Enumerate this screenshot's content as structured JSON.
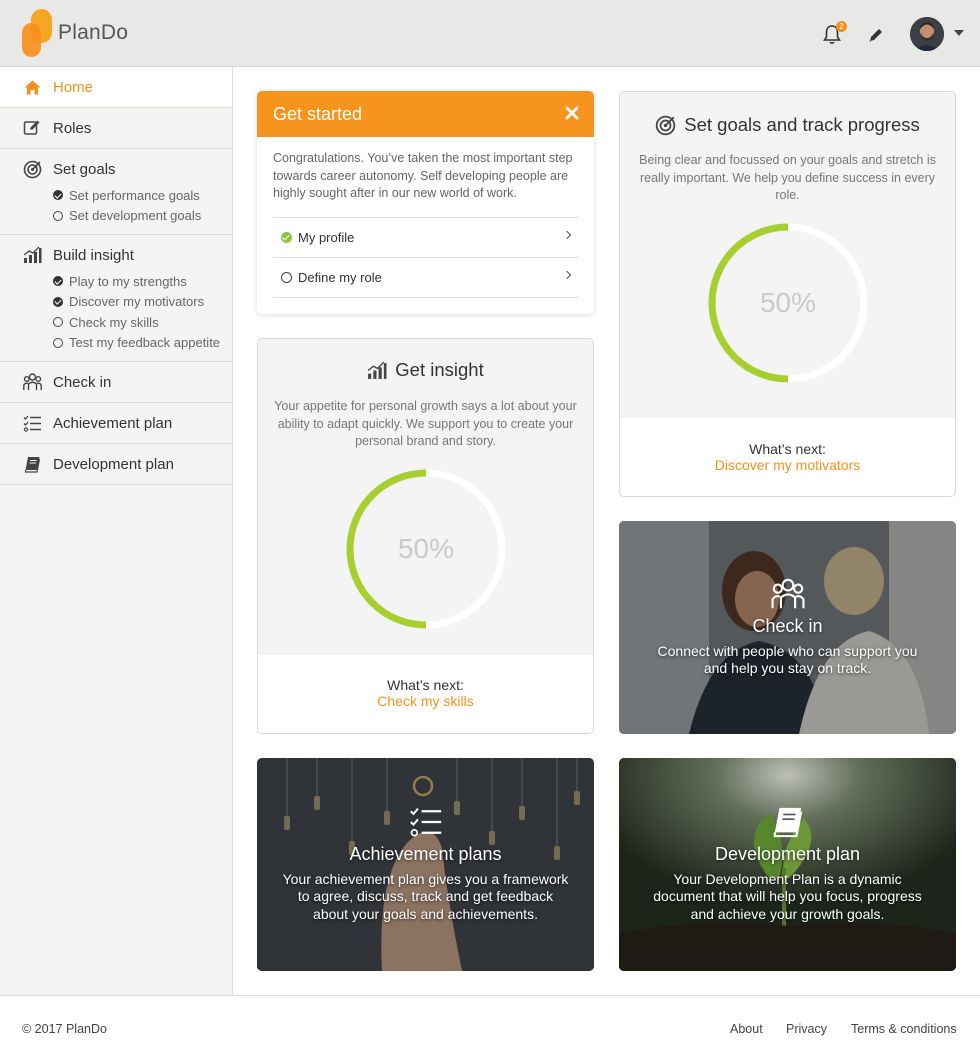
{
  "header": {
    "brand": "PlanDo",
    "notification_count": "2"
  },
  "sidebar": {
    "items": [
      {
        "label": "Home",
        "icon": "home-icon",
        "active": true
      },
      {
        "label": "Roles",
        "icon": "edit-icon"
      },
      {
        "label": "Set goals",
        "icon": "target-icon",
        "subitems": [
          {
            "label": "Set performance goals",
            "done": true
          },
          {
            "label": "Set development goals",
            "done": false
          }
        ]
      },
      {
        "label": "Build insight",
        "icon": "bar-chart-icon",
        "subitems": [
          {
            "label": "Play to my strengths",
            "done": true
          },
          {
            "label": "Discover my motivators",
            "done": true
          },
          {
            "label": "Check my skills",
            "done": false
          },
          {
            "label": "Test my feedback appetite",
            "done": false
          }
        ]
      },
      {
        "label": "Check in",
        "icon": "people-icon"
      },
      {
        "label": "Achievement plan",
        "icon": "checklist-icon"
      },
      {
        "label": "Development plan",
        "icon": "book-icon"
      }
    ]
  },
  "get_started": {
    "title": "Get started",
    "text": "Congratulations. You’ve taken the most important step towards career autonomy. Self developing people are highly sought after in our new world of work.",
    "links": [
      {
        "label": "My profile",
        "done": true
      },
      {
        "label": "Define my role",
        "done": false
      }
    ]
  },
  "get_insight": {
    "title": "Get insight",
    "text": "Your appetite for personal growth says a lot about your ability to adapt quickly. We support you to create your personal brand and story.",
    "progress": 50,
    "progress_label": "50%",
    "next_label": "What’s next:",
    "next_link": "Check my skills"
  },
  "set_goals": {
    "title": "Set goals and track progress",
    "text": "Being clear and focussed on your goals and stretch is really important. We help you define success in every role.",
    "progress": 50,
    "progress_label": "50%",
    "next_label": "What’s next:",
    "next_link": "Discover my motivators"
  },
  "check_in": {
    "title": "Check in",
    "text": "Connect with people who can support you and help you stay on track."
  },
  "achievement": {
    "title": "Achievement plans",
    "text": "Your achievement plan gives you a framework to agree, discuss, track and get feedback about your goals and achievements."
  },
  "development": {
    "title": "Development plan",
    "text": "Your Development Plan is a dynamic document that will help you focus, progress and achieve your growth goals."
  },
  "footer": {
    "copyright": "© 2017 PlanDo",
    "links": [
      "About",
      "Privacy",
      "Terms & conditions"
    ]
  },
  "colors": {
    "accent": "#f5921e",
    "progress": "#a7cf2f",
    "success": "#8cc63f"
  }
}
